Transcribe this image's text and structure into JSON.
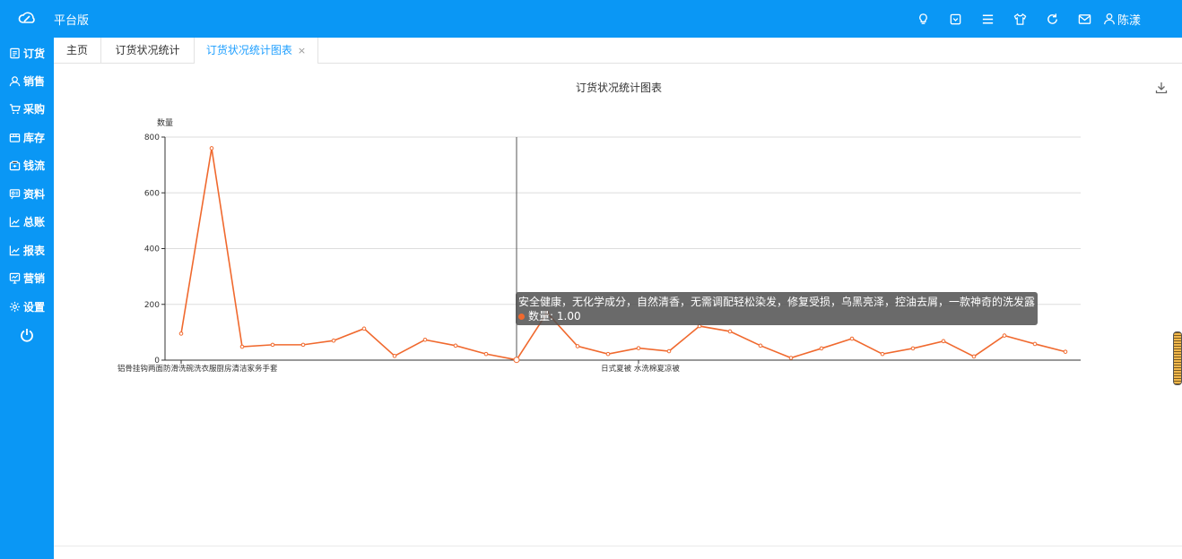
{
  "app": {
    "title": "平台版",
    "user": "陈漾"
  },
  "top_icons": [
    "lightbulb-icon",
    "box-icon",
    "menu-icon",
    "shirt-icon",
    "refresh-icon",
    "mail-icon"
  ],
  "sidebar": {
    "items": [
      {
        "label": "订货",
        "icon": "order-icon"
      },
      {
        "label": "销售",
        "icon": "sales-icon"
      },
      {
        "label": "采购",
        "icon": "cart-icon"
      },
      {
        "label": "库存",
        "icon": "inventory-icon"
      },
      {
        "label": "钱流",
        "icon": "wallet-icon"
      },
      {
        "label": "资料",
        "icon": "profile-icon"
      },
      {
        "label": "总账",
        "icon": "ledger-icon"
      },
      {
        "label": "报表",
        "icon": "report-icon"
      },
      {
        "label": "营销",
        "icon": "marketing-icon"
      },
      {
        "label": "设置",
        "icon": "settings-icon"
      }
    ]
  },
  "tabs": [
    {
      "label": "主页"
    },
    {
      "label": "订货状况统计"
    },
    {
      "label": "订货状况统计图表",
      "close": "×"
    }
  ],
  "chart_data": {
    "type": "line",
    "title": "订货状况统计图表",
    "ylabel": "数量",
    "ylim": [
      0,
      800
    ],
    "yticks": [
      0,
      200,
      400,
      600,
      800
    ],
    "xtick_labels": [
      "铝骨挂钩两面防滑洗碗洗衣服厨房清洁家务手套",
      "日式夏被 水洗棉夏凉被"
    ],
    "series": [
      {
        "values": [
          95,
          760,
          48,
          55,
          55,
          70,
          113,
          15,
          73,
          52,
          22,
          1,
          170,
          50,
          22,
          43,
          32,
          122,
          103,
          52,
          8,
          42,
          77,
          22,
          42,
          68,
          13,
          88,
          58,
          30
        ]
      }
    ],
    "color": "#f0692e",
    "tooltip": {
      "name": "安全健康，无化学成分，自然清香，无需调配轻松染发，修复受损，乌黑亮泽，控油去屑，一款神奇的洗发露",
      "series_label": "数量",
      "value": "1.00"
    }
  }
}
